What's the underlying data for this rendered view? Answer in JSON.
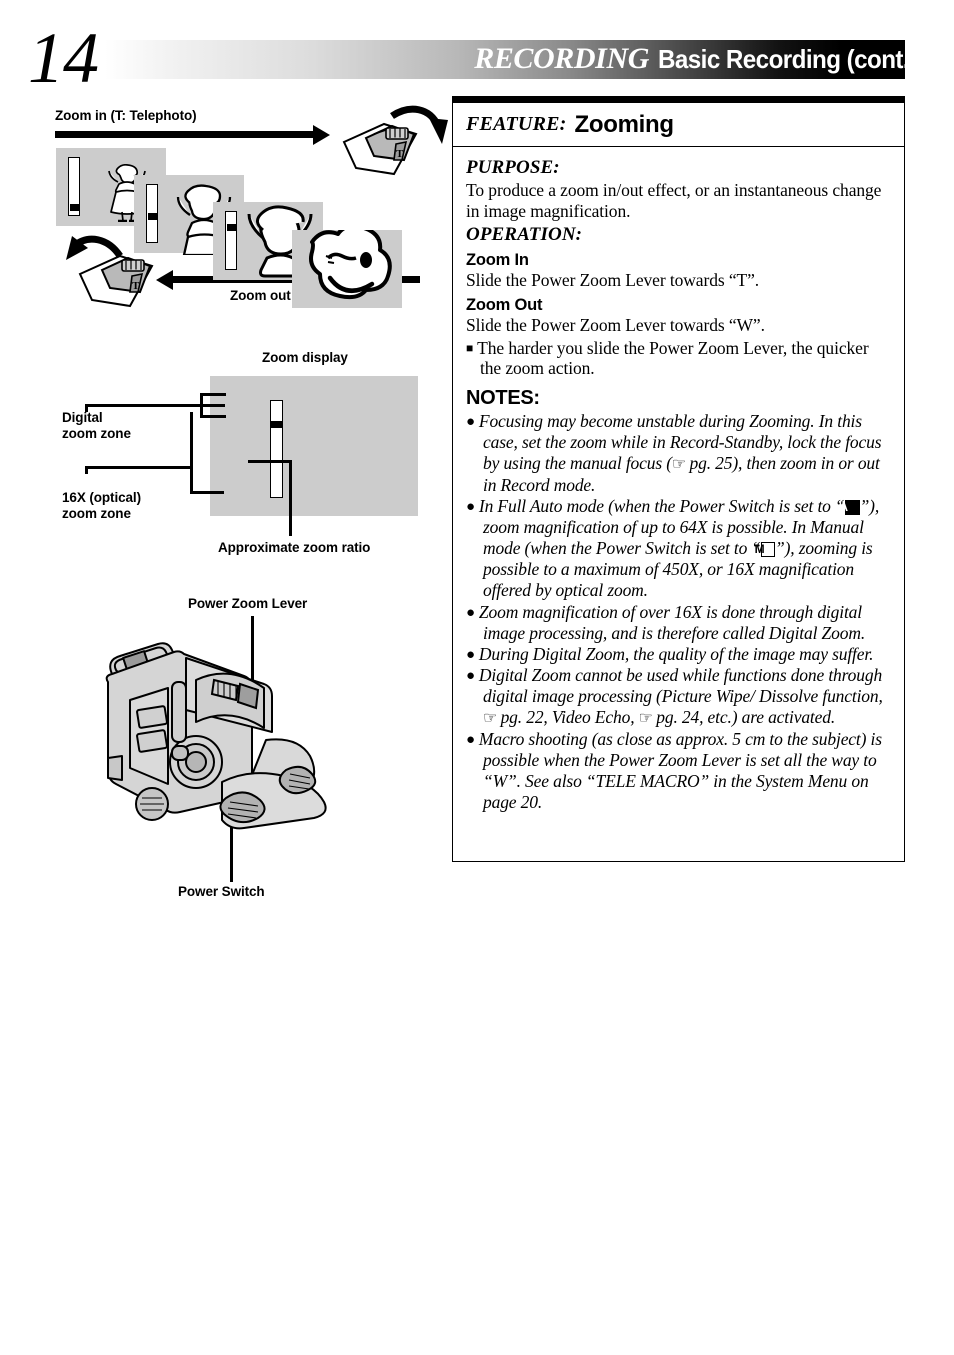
{
  "header": {
    "page_number": "14",
    "title_main": "RECORDING",
    "title_sub": "Basic Recording (cont.)"
  },
  "illustrations": {
    "zoom_sequence": {
      "zoom_in_label": "Zoom in (T: Telephoto)",
      "zoom_out_label": "Zoom out (W: Wide angle)",
      "frame_count": 4
    },
    "zoom_display": {
      "title": "Zoom display",
      "digital_zone_label_line1": "Digital",
      "digital_zone_label_line2": "zoom zone",
      "optical_zone_label_line1": "16X (optical)",
      "optical_zone_label_line2": "zoom zone",
      "ratio_label": "Approximate zoom ratio"
    },
    "camcorder": {
      "power_zoom_lever_label": "Power Zoom Lever",
      "power_switch_label": "Power Switch"
    }
  },
  "feature_panel": {
    "kicker": "FEATURE:",
    "title": "Zooming",
    "purpose_heading": "PURPOSE:",
    "purpose_text": "To produce a zoom in/out effect, or an instantaneous change in image magnification.",
    "operation_heading": "OPERATION:",
    "zoom_in_heading": "Zoom In",
    "zoom_in_text": "Slide the Power Zoom Lever towards “T”.",
    "zoom_out_heading": "Zoom Out",
    "zoom_out_text": "Slide the Power Zoom Lever towards “W”.",
    "square_note": "The harder you slide the Power Zoom Lever, the quicker the zoom action.",
    "notes_heading": "NOTES:",
    "notes": [
      {
        "parts": [
          {
            "t": "text",
            "v": "Focusing may become unstable during Zooming. In this case, set the zoom while in Record-Standby, lock the focus by using the manual focus ("
          },
          {
            "t": "hand",
            "v": "☞"
          },
          {
            "t": "text",
            "v": " pg. 25), then zoom in or out in Record mode."
          }
        ]
      },
      {
        "parts": [
          {
            "t": "text",
            "v": "In Full Auto mode (when the Power Switch is set to “"
          },
          {
            "t": "badge-a",
            "v": "A"
          },
          {
            "t": "text",
            "v": "”), zoom magnification of up to 64X is possible. In Manual mode (when the Power Switch is set to “"
          },
          {
            "t": "badge-m",
            "v": "M"
          },
          {
            "t": "text",
            "v": "”), zooming is possible to a maximum of 450X, or 16X magnification offered by optical zoom."
          }
        ]
      },
      {
        "parts": [
          {
            "t": "text",
            "v": "Zoom magnification of over 16X is done through digital image processing, and is therefore called Digital Zoom."
          }
        ]
      },
      {
        "parts": [
          {
            "t": "text",
            "v": "During Digital Zoom, the quality of the image may suffer."
          }
        ]
      },
      {
        "parts": [
          {
            "t": "text",
            "v": "Digital Zoom cannot be used while functions done through digital image processing (Picture Wipe/ Dissolve function, "
          },
          {
            "t": "hand",
            "v": "☞"
          },
          {
            "t": "text",
            "v": " pg. 22, Video Echo, "
          },
          {
            "t": "hand",
            "v": "☞"
          },
          {
            "t": "text",
            "v": " pg. 24, etc.) are activated."
          }
        ]
      },
      {
        "parts": [
          {
            "t": "text",
            "v": "Macro shooting (as close as approx. 5 cm to the subject) is possible when the Power Zoom Lever is set all the way to “W”. See also “TELE MACRO” in the System Menu on page 20."
          }
        ]
      }
    ]
  },
  "colors": {
    "frame_gray": "#cccccc",
    "body_gray": "#d5d5d5",
    "ink": "#000000"
  }
}
